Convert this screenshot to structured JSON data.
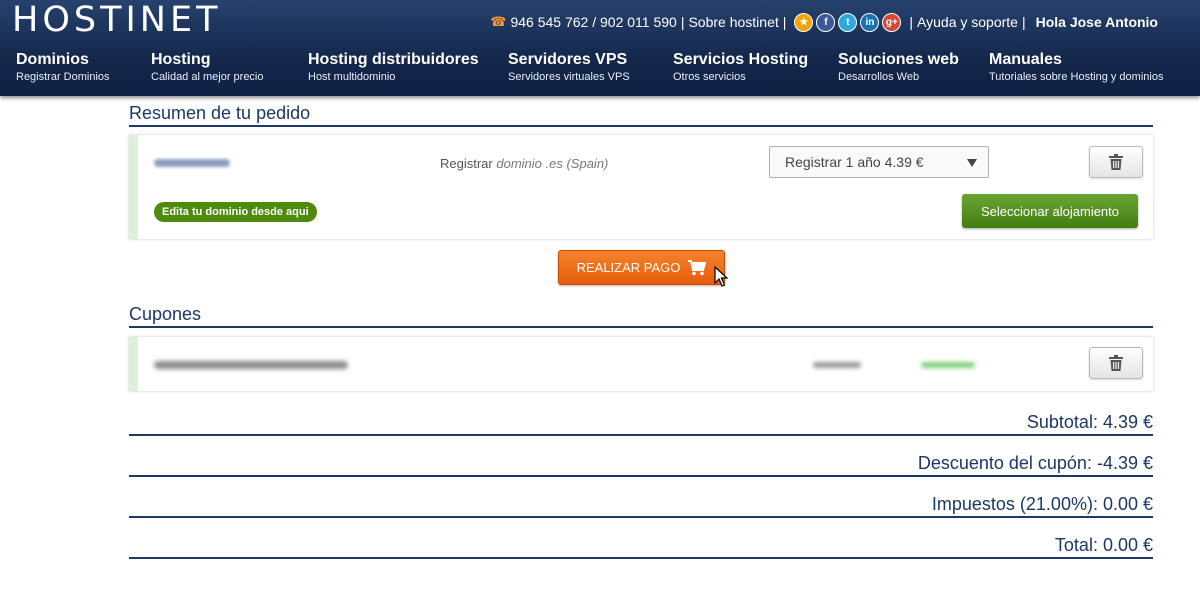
{
  "header": {
    "logo": "HOSTINET",
    "phone": "946 545 762 / 902 011 590",
    "about": "Sobre hostinet",
    "help": "Ayuda y soporte",
    "greeting": "Hola Jose Antonio",
    "social": [
      {
        "icon": "star-icon",
        "glyph": "★"
      },
      {
        "icon": "facebook-icon",
        "glyph": "f"
      },
      {
        "icon": "twitter-icon",
        "glyph": "t"
      },
      {
        "icon": "linkedin-icon",
        "glyph": "in"
      },
      {
        "icon": "google-plus-icon",
        "glyph": "g+"
      }
    ]
  },
  "nav": [
    {
      "title": "Dominios",
      "subtitle": "Registrar Dominios"
    },
    {
      "title": "Hosting",
      "subtitle": "Calidad al mejor precio"
    },
    {
      "title": "Hosting distribuidores",
      "subtitle": "Host multidominio"
    },
    {
      "title": "Servidores VPS",
      "subtitle": "Servidores virtuales VPS"
    },
    {
      "title": "Servicios Hosting",
      "subtitle": "Otros servicios"
    },
    {
      "title": "Soluciones web",
      "subtitle": "Desarrollos Web"
    },
    {
      "title": "Manuales",
      "subtitle": "Tutoriales sobre Hosting y dominios"
    }
  ],
  "order": {
    "title": "Resumen de tu pedido",
    "register_prefix": "Registrar",
    "register_domain": "dominio .es (Spain)",
    "select_value": "Registrar 1 año 4.39 €",
    "edit_label": "Edita tu dominio desde aqui",
    "select_hosting_label": "Seleccionar alojamiento"
  },
  "pay_label": "REALIZAR PAGO",
  "coupons": {
    "title": "Cupones"
  },
  "totals": {
    "subtotal": "Subtotal: 4.39 €",
    "discount": "Descuento del cupón: -4.39 €",
    "taxes": "Impuestos (21.00%): 0.00 €",
    "total": "Total: 0.00 €"
  },
  "colors": {
    "header": "#14284c",
    "accent_blue": "#1b3868",
    "green": "#4d8a0e",
    "orange": "#f5822d"
  }
}
